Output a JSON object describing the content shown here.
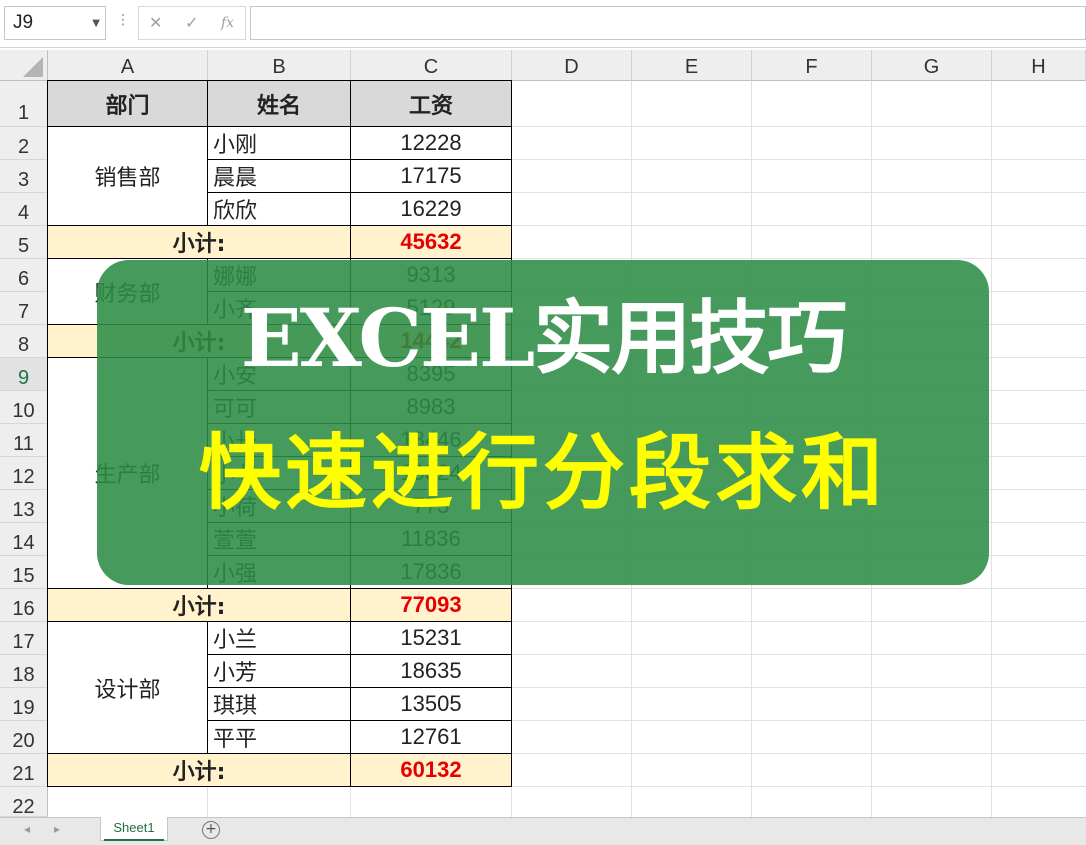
{
  "formula_bar": {
    "name_box": "J9",
    "cancel_icon": "✕",
    "enter_icon": "✓",
    "fx_label": "fx",
    "formula": ""
  },
  "columns": [
    "A",
    "B",
    "C",
    "D",
    "E",
    "F",
    "G",
    "H"
  ],
  "rows": [
    "1",
    "2",
    "3",
    "4",
    "5",
    "6",
    "7",
    "8",
    "9",
    "10",
    "11",
    "12",
    "13",
    "14",
    "15",
    "16",
    "17",
    "18",
    "19",
    "20",
    "21",
    "22"
  ],
  "selected_row": "9",
  "table": {
    "headers": [
      "部门",
      "姓名",
      "工资"
    ],
    "groups": [
      {
        "dept": "销售部",
        "members": [
          {
            "name": "小刚",
            "salary": "12228"
          },
          {
            "name": "晨晨",
            "salary": "17175"
          },
          {
            "name": "欣欣",
            "salary": "16229"
          }
        ],
        "subtotal_label": "小计:",
        "subtotal": "45632"
      },
      {
        "dept": "财务部",
        "members": [
          {
            "name": "娜娜",
            "salary": "9313"
          },
          {
            "name": "小齐",
            "salary": "5129"
          }
        ],
        "subtotal_label": "小计:",
        "subtotal": "14442"
      },
      {
        "dept": "生产部",
        "members": [
          {
            "name": "小安",
            "salary": "8395"
          },
          {
            "name": "可可",
            "salary": "8983"
          },
          {
            "name": "小长",
            "salary": "18446"
          },
          {
            "name": "小七",
            "salary": "10824"
          },
          {
            "name": "小荷",
            "salary": "773"
          },
          {
            "name": "萱萱",
            "salary": "11836"
          },
          {
            "name": "小强",
            "salary": "17836"
          }
        ],
        "subtotal_label": "小计:",
        "subtotal": "77093"
      },
      {
        "dept": "设计部",
        "members": [
          {
            "name": "小兰",
            "salary": "15231"
          },
          {
            "name": "小芳",
            "salary": "18635"
          },
          {
            "name": "琪琪",
            "salary": "13505"
          },
          {
            "name": "平平",
            "salary": "12761"
          }
        ],
        "subtotal_label": "小计:",
        "subtotal": "60132"
      }
    ]
  },
  "banner": {
    "line1": "EXCEL实用技巧",
    "line2": "快速进行分段求和"
  },
  "sheet_tabs": [
    "Sheet1"
  ],
  "add_sheet_icon": "+",
  "colors": {
    "header_fill": "#d9d9d9",
    "subtotal_fill": "#fff2cc",
    "subtotal_text": "#e60000",
    "banner_green": "#2c8c46",
    "banner_yellow": "#ffff00",
    "excel_green": "#217346"
  }
}
